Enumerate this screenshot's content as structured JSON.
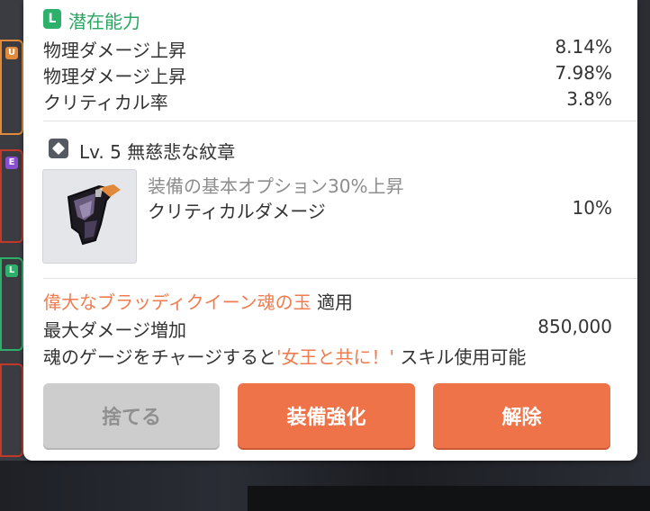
{
  "background_tabs": [
    {
      "letter": "U",
      "color": "#e08a3a"
    },
    {
      "letter": "E",
      "color": "#8a4fd0"
    },
    {
      "letter": "L",
      "color": "#2db06a"
    }
  ],
  "potential": {
    "badge": "L",
    "title": "潜在能力",
    "lines": [
      {
        "label": "物理ダメージ上昇",
        "value": "8.14%"
      },
      {
        "label": "物理ダメージ上昇",
        "value": "7.98%"
      },
      {
        "label": "クリティカル率",
        "value": "3.8%"
      }
    ]
  },
  "emblem": {
    "title": "Lv. 5 無慈悲な紋章",
    "option_text": "装備の基本オプション30%上昇",
    "stat_label": "クリティカルダメージ",
    "stat_value": "10%"
  },
  "soul": {
    "name": "偉大なブラッディクイーン魂の玉",
    "apply": " 適用",
    "stat_label": "最大ダメージ増加",
    "stat_value": "850,000",
    "desc_prefix": "魂のゲージをチャージすると",
    "desc_quote": "'女王と共に！'",
    "desc_suffix": " スキル使用可能"
  },
  "buttons": {
    "discard": "捨てる",
    "enhance": "装備強化",
    "release": "解除"
  },
  "colors": {
    "accent": "#ef7349",
    "potential_green": "#2aa562",
    "soul_orange": "#ef7b4f"
  }
}
